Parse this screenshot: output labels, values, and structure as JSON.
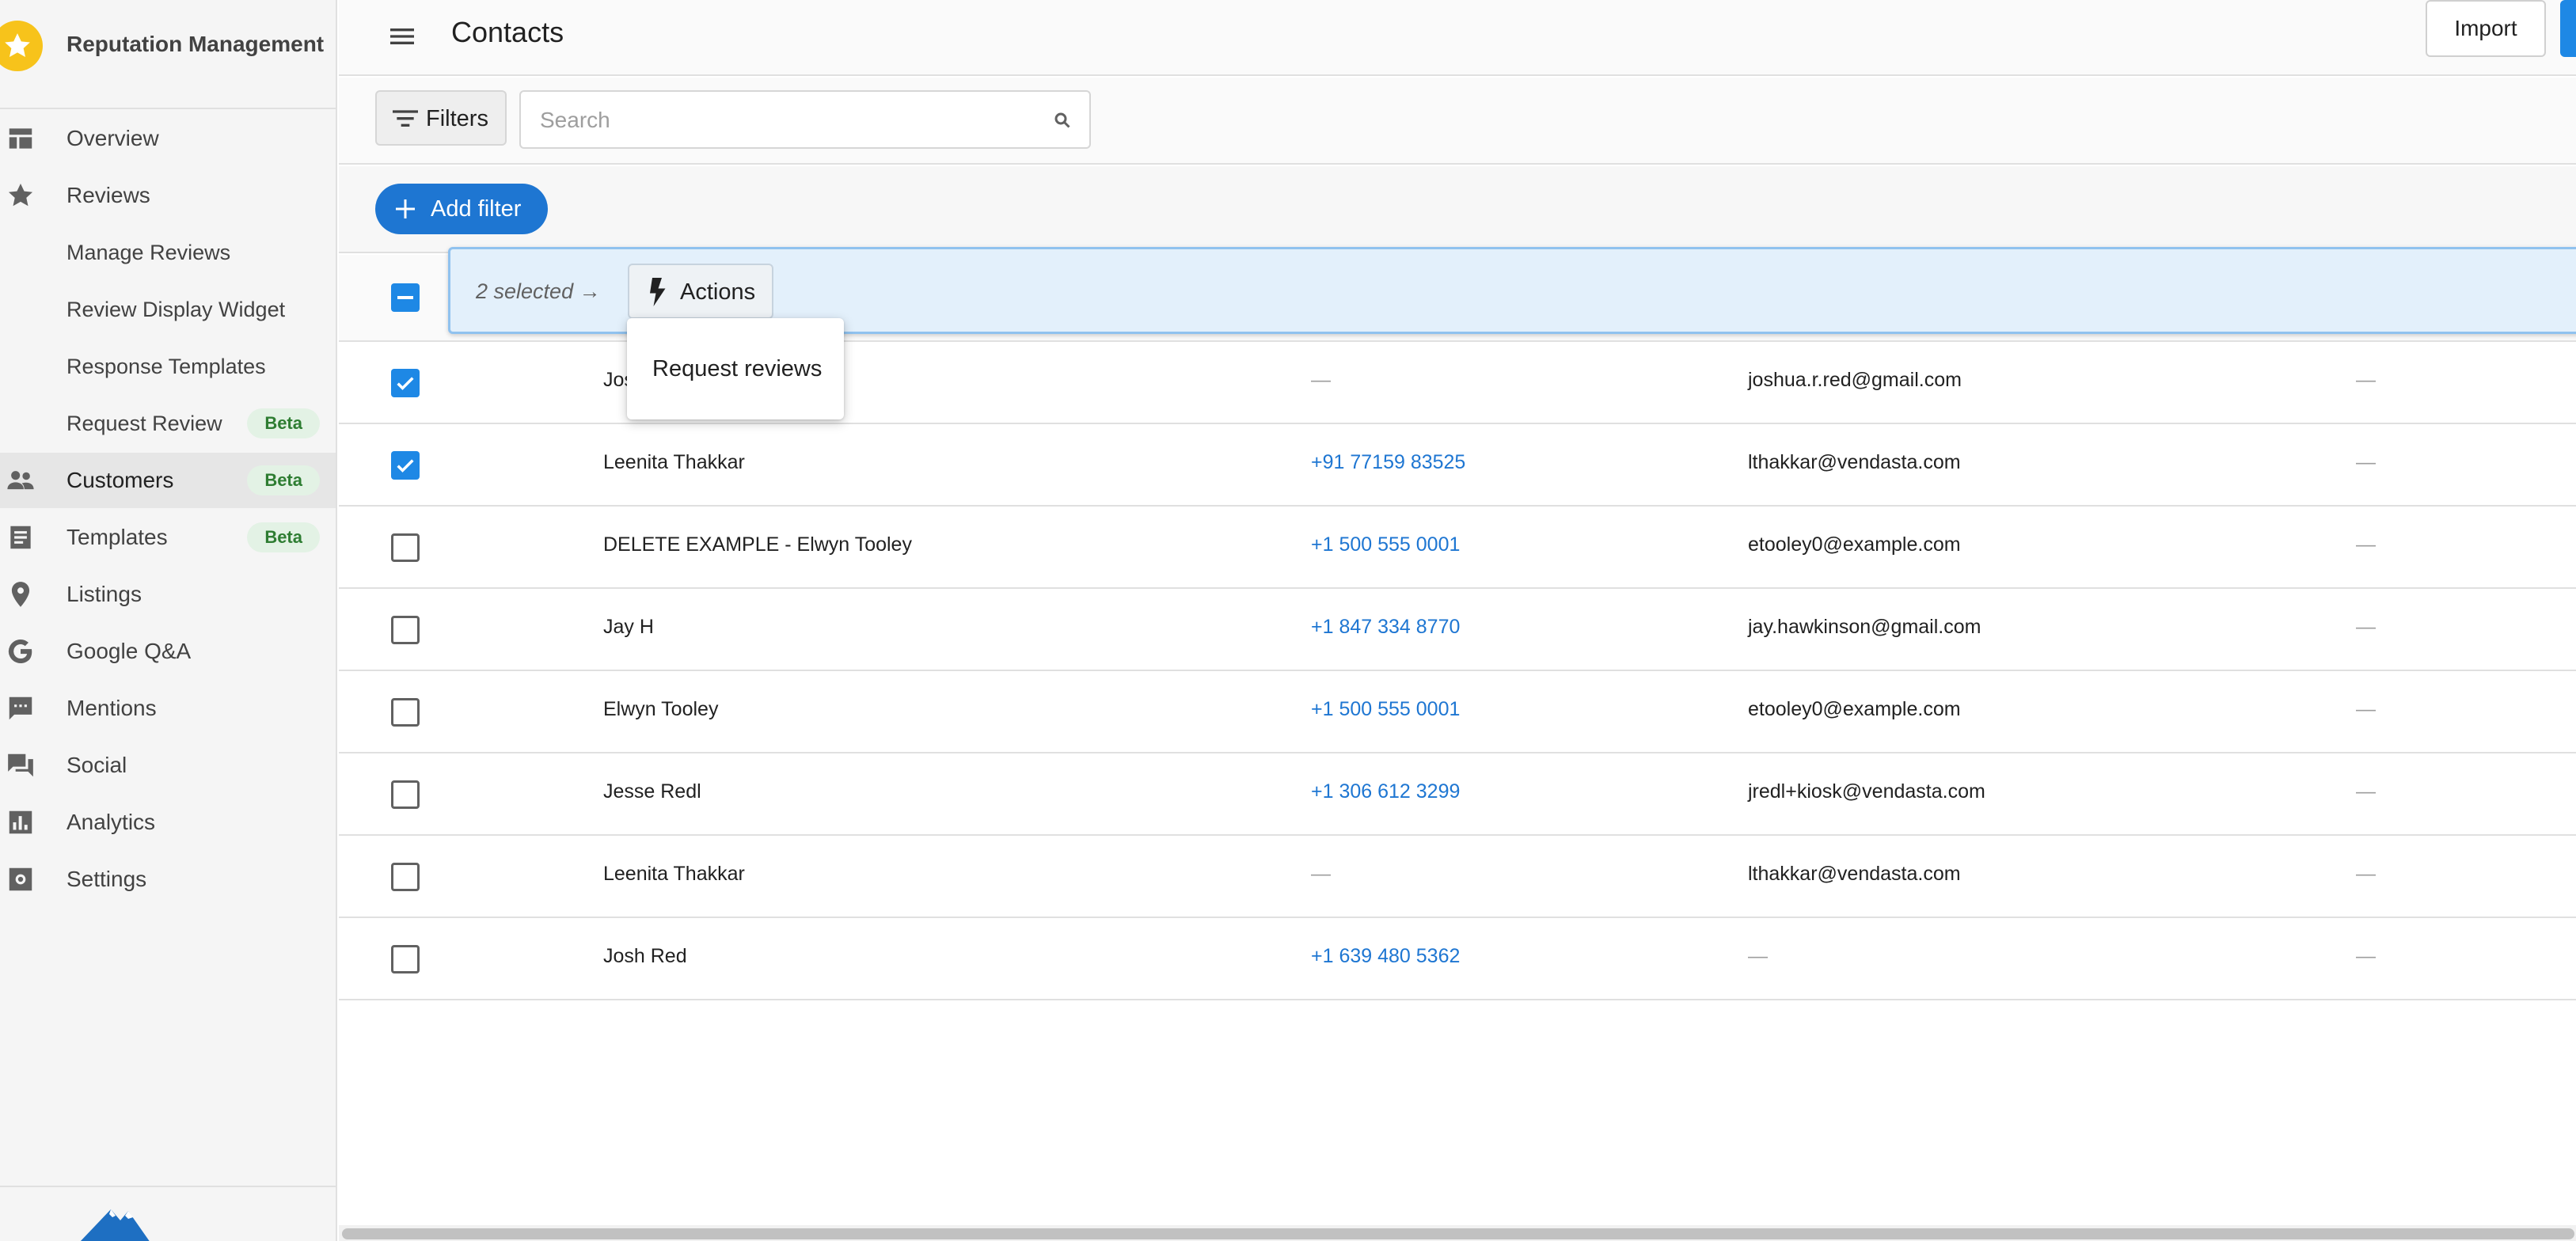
{
  "brand": {
    "title": "Reputation Management",
    "accent": "#f7c31b"
  },
  "sidebar": {
    "items": [
      {
        "label": "Overview",
        "icon": "dashboard-icon"
      },
      {
        "label": "Reviews",
        "icon": "star-icon"
      },
      {
        "label": "Manage Reviews"
      },
      {
        "label": "Review Display Widget"
      },
      {
        "label": "Response Templates"
      },
      {
        "label": "Request Review",
        "badge": "Beta"
      },
      {
        "label": "Customers",
        "icon": "people-icon",
        "badge": "Beta",
        "active": true
      },
      {
        "label": "Templates",
        "icon": "document-icon",
        "badge": "Beta"
      },
      {
        "label": "Listings",
        "icon": "location-pin-icon"
      },
      {
        "label": "Google Q&A",
        "icon": "google-icon"
      },
      {
        "label": "Mentions",
        "icon": "chat-bubble-icon"
      },
      {
        "label": "Social",
        "icon": "forum-icon"
      },
      {
        "label": "Analytics",
        "icon": "bar-chart-icon"
      },
      {
        "label": "Settings",
        "icon": "gear-icon"
      }
    ]
  },
  "header": {
    "title": "Contacts",
    "import_label": "Import"
  },
  "toolbar": {
    "filters_label": "Filters",
    "search_placeholder": "Search",
    "search_value": ""
  },
  "filter_row": {
    "add_filter_label": "Add filter"
  },
  "selection": {
    "text": "2 selected →",
    "actions_label": "Actions"
  },
  "menu": {
    "items": [
      "Request reviews"
    ]
  },
  "table": {
    "rows": [
      {
        "checked": true,
        "name": "Jos",
        "phone": "—",
        "email": "joshua.r.red@gmail.com",
        "extra": "—"
      },
      {
        "checked": true,
        "name": "Leenita Thakkar",
        "phone": "+91 77159 83525",
        "email": "lthakkar@vendasta.com",
        "extra": "—"
      },
      {
        "checked": false,
        "name": "DELETE EXAMPLE - Elwyn Tooley",
        "phone": "+1 500 555 0001",
        "email": "etooley0@example.com",
        "extra": "—"
      },
      {
        "checked": false,
        "name": "Jay H",
        "phone": "+1 847 334 8770",
        "email": "jay.hawkinson@gmail.com",
        "extra": "—"
      },
      {
        "checked": false,
        "name": "Elwyn Tooley",
        "phone": "+1 500 555 0001",
        "email": "etooley0@example.com",
        "extra": "—"
      },
      {
        "checked": false,
        "name": "Jesse Redl",
        "phone": "+1 306 612 3299",
        "email": "jredl+kiosk@vendasta.com",
        "extra": "—"
      },
      {
        "checked": false,
        "name": "Leenita Thakkar",
        "phone": "—",
        "email": "lthakkar@vendasta.com",
        "extra": "—"
      },
      {
        "checked": false,
        "name": "Josh Red",
        "phone": "+1 639 480 5362",
        "email": "—",
        "extra": "—"
      }
    ]
  },
  "colors": {
    "primary": "#1e76d2",
    "selection_bg": "#e3f0fb",
    "beta_bg": "#e3f2e5",
    "beta_text": "#2e7d32"
  }
}
